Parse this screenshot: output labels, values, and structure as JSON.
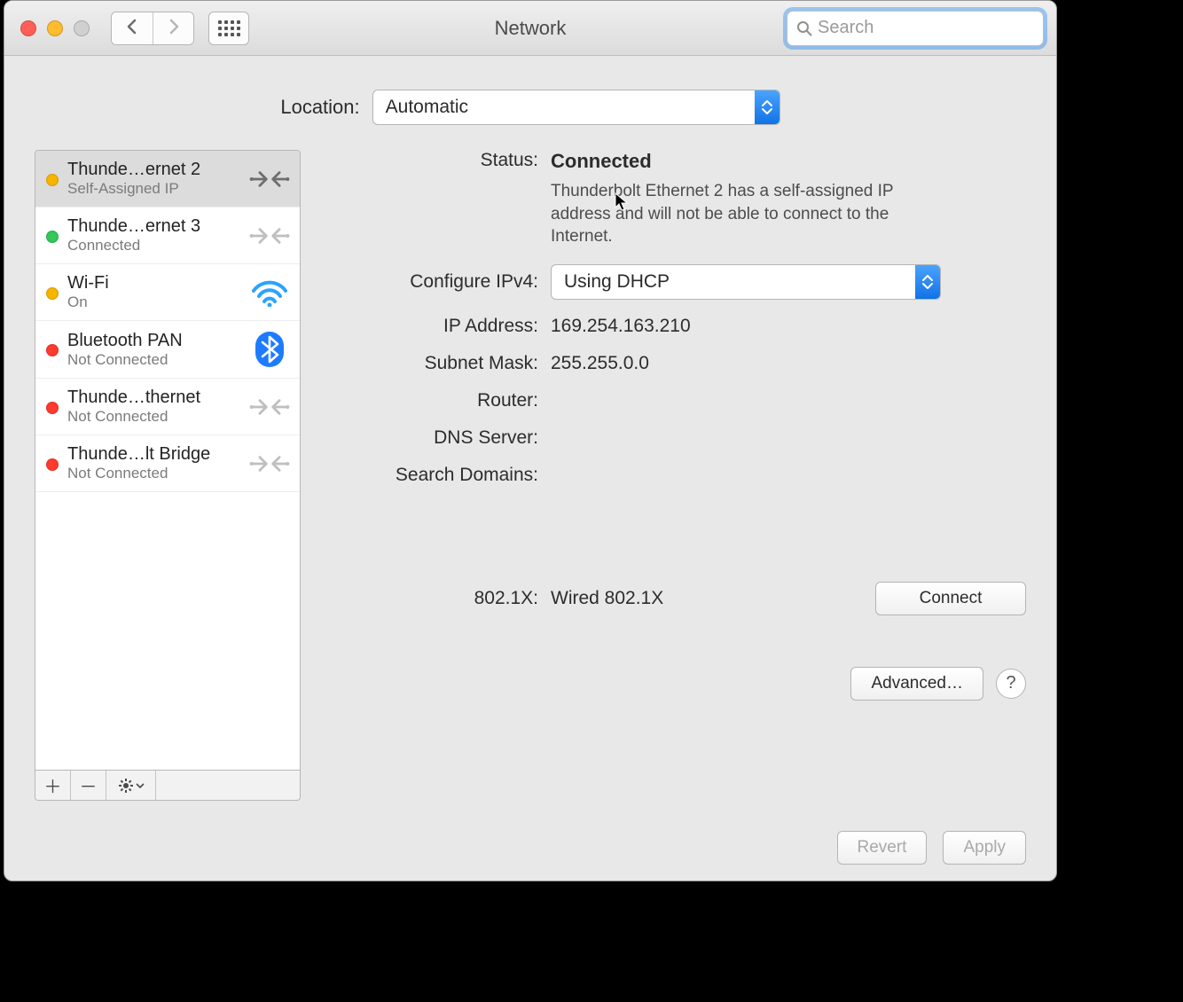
{
  "title": "Network",
  "search_placeholder": "Search",
  "location": {
    "label": "Location:",
    "value": "Automatic"
  },
  "services": [
    {
      "name": "Thunde…ernet 2",
      "status_text": "Self-Assigned IP",
      "led": "amber",
      "icon": "ethernet",
      "selected": true
    },
    {
      "name": "Thunde…ernet 3",
      "status_text": "Connected",
      "led": "green",
      "icon": "ethernet",
      "selected": false
    },
    {
      "name": "Wi-Fi",
      "status_text": "On",
      "led": "amber",
      "icon": "wifi",
      "selected": false
    },
    {
      "name": "Bluetooth PAN",
      "status_text": "Not Connected",
      "led": "red",
      "icon": "bluetooth",
      "selected": false
    },
    {
      "name": "Thunde…thernet",
      "status_text": "Not Connected",
      "led": "red",
      "icon": "ethernet",
      "selected": false
    },
    {
      "name": "Thunde…lt Bridge",
      "status_text": "Not Connected",
      "led": "red",
      "icon": "ethernet",
      "selected": false
    }
  ],
  "status": {
    "label": "Status:",
    "value": "Connected",
    "message": "Thunderbolt Ethernet 2 has a self-assigned IP address and will not be able to connect to the Internet."
  },
  "configure_ipv4": {
    "label": "Configure IPv4:",
    "value": "Using DHCP"
  },
  "ip_address": {
    "label": "IP Address:",
    "value": "169.254.163.210"
  },
  "subnet_mask": {
    "label": "Subnet Mask:",
    "value": "255.255.0.0"
  },
  "router": {
    "label": "Router:",
    "value": ""
  },
  "dns_server": {
    "label": "DNS Server:",
    "value": ""
  },
  "search_domains": {
    "label": "Search Domains:",
    "value": ""
  },
  "eight02": {
    "label": "802.1X:",
    "value": "Wired 802.1X",
    "button": "Connect"
  },
  "advanced_label": "Advanced…",
  "revert_label": "Revert",
  "apply_label": "Apply"
}
